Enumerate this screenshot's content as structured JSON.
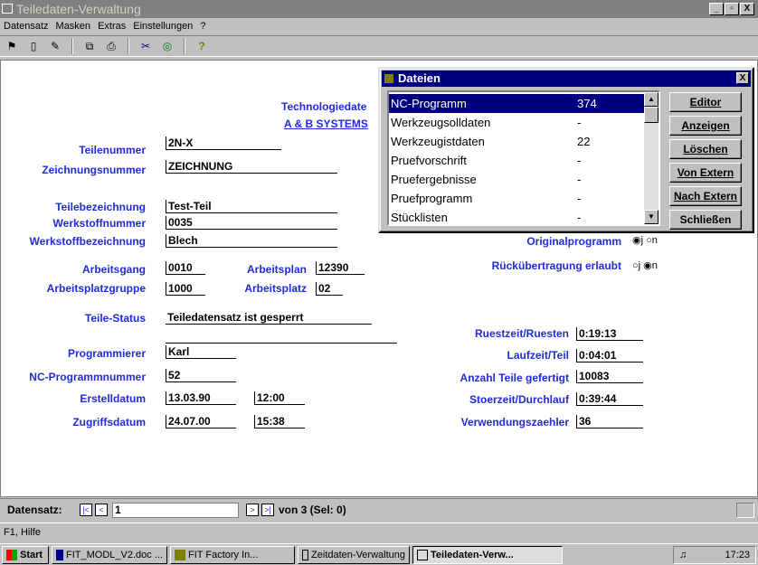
{
  "window": {
    "title": "Teiledaten-Verwaltung",
    "buttons": [
      "_",
      "▫",
      "X"
    ]
  },
  "menu": [
    "Datensatz",
    "Masken",
    "Extras",
    "Einstellungen",
    "?"
  ],
  "toolbar": {
    "icons": [
      "binoculars-icon",
      "new-icon",
      "edit-icon",
      "copy-icon",
      "print-icon",
      "cut-icon",
      "eye-icon",
      "help-icon"
    ]
  },
  "header": {
    "line1": "Technologiedate",
    "line2": "A & B SYSTEMS"
  },
  "form": {
    "teilenummer": {
      "label": "Teilenummer",
      "value": "2N-X"
    },
    "zeichnungsnummer": {
      "label": "Zeichnungsnummer",
      "value": "ZEICHNUNG"
    },
    "teilebezeichnung": {
      "label": "Teilebezeichnung",
      "value": "Test-Teil"
    },
    "werkstoffnummer": {
      "label": "Werkstoffnummer",
      "value": "0035"
    },
    "werkstoffbezeichnung": {
      "label": "Werkstoffbezeichnung",
      "value": "Blech"
    },
    "arbeitsgang": {
      "label": "Arbeitsgang",
      "value": "0010"
    },
    "arbeitsplan": {
      "label": "Arbeitsplan",
      "value": "12390"
    },
    "arbeitsplatzgruppe": {
      "label": "Arbeitsplatzgruppe",
      "value": "1000"
    },
    "arbeitsplatz": {
      "label": "Arbeitsplatz",
      "value": "02"
    },
    "teilestatus": {
      "label": "Teile-Status",
      "value": "Teiledatensatz ist gesperrt"
    },
    "programmierer": {
      "label": "Programmierer",
      "value": "Karl"
    },
    "ncprogrammnummer": {
      "label": "NC-Programmnummer",
      "value": "52"
    },
    "erstelldatum": {
      "label": "Erstelldatum",
      "date": "13.03.90",
      "time": "12:00"
    },
    "zugriffsdatum": {
      "label": "Zugriffsdatum",
      "date": "24.07.00",
      "time": "15:38"
    },
    "originalprogramm": {
      "label": "Originalprogramm",
      "radio": "◉j ○n"
    },
    "rueckuebertragung": {
      "label": "Rückübertragung erlaubt",
      "radio": "○j ◉n"
    },
    "ruestzeit": {
      "label": "Ruestzeit/Ruesten",
      "value": "0:19:13"
    },
    "laufzeit": {
      "label": "Laufzeit/Teil",
      "value": "0:04:01"
    },
    "anzahlteile": {
      "label": "Anzahl Teile gefertigt",
      "value": "10083"
    },
    "stoerzeit": {
      "label": "Stoerzeit/Durchlauf",
      "value": "0:39:44"
    },
    "verwendungszaehler": {
      "label": "Verwendungszaehler",
      "value": "36"
    }
  },
  "nav": {
    "label": "Datensatz:",
    "current": "1",
    "of": "von 3 (Sel: 0)"
  },
  "hint": "F1, Hilfe",
  "dialog": {
    "title": "Dateien",
    "items": [
      {
        "name": "NC-Programm",
        "count": "374"
      },
      {
        "name": "Werkzeugsolldaten",
        "count": "-"
      },
      {
        "name": "Werkzeugistdaten",
        "count": "22"
      },
      {
        "name": "Pruefvorschrift",
        "count": "-"
      },
      {
        "name": "Pruefergebnisse",
        "count": "-"
      },
      {
        "name": "Pruefprogramm",
        "count": "-"
      },
      {
        "name": "Stücklisten",
        "count": "-"
      }
    ],
    "buttons": [
      "Editor",
      "Anzeigen",
      "Löschen",
      "Von Extern",
      "Nach Extern",
      "Schließen"
    ]
  },
  "taskbar": {
    "start": "Start",
    "items": [
      "FIT_MODL_V2.doc ...",
      "FIT Factory In...",
      "Zeitdaten-Verwaltung",
      "Teiledaten-Verw..."
    ],
    "clock": "17:23"
  }
}
